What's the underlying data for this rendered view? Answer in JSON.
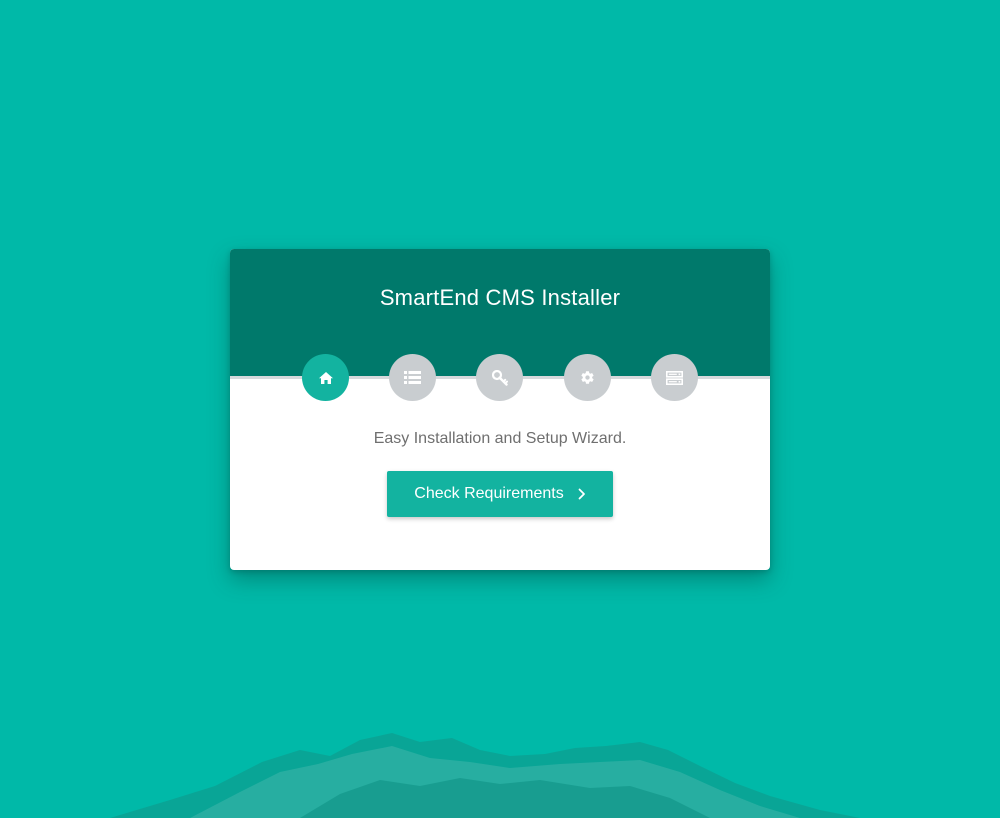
{
  "installer": {
    "title": "SmartEnd CMS Installer",
    "subtitle": "Easy Installation and Setup Wizard.",
    "primary_button_label": "Check Requirements"
  },
  "steps": [
    {
      "icon": "home-icon",
      "state": "active"
    },
    {
      "icon": "list-icon",
      "state": "inactive"
    },
    {
      "icon": "key-icon",
      "state": "inactive"
    },
    {
      "icon": "gear-icon",
      "state": "inactive"
    },
    {
      "icon": "server-icon",
      "state": "inactive"
    }
  ],
  "colors": {
    "background": "#00b9a8",
    "header": "#00796b",
    "accent": "#13b3a0",
    "inactive_step": "#c9cdd0"
  }
}
